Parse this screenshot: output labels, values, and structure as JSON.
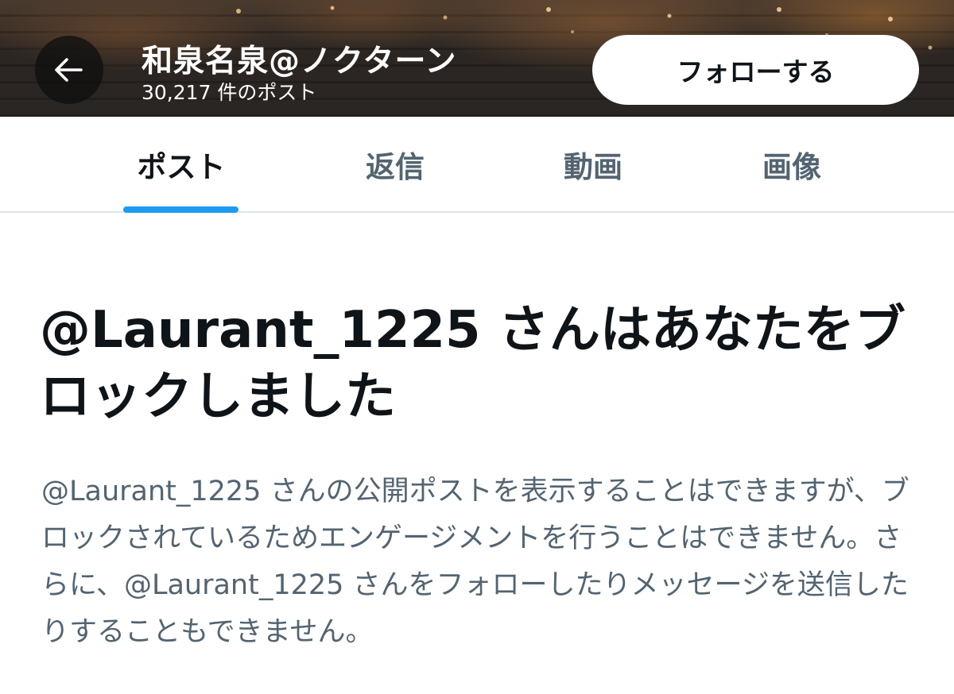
{
  "header": {
    "profile_name": "和泉名泉@ノクターン",
    "post_count": "30,217 件のポスト",
    "follow_label": "フォローする",
    "back_icon": "arrow-left-icon"
  },
  "tabs": [
    {
      "label": "ポスト",
      "active": true
    },
    {
      "label": "返信",
      "active": false
    },
    {
      "label": "動画",
      "active": false
    },
    {
      "label": "画像",
      "active": false
    }
  ],
  "message": {
    "title": "@Laurant_1225 さんはあなたをブロックしました",
    "description": "@Laurant_1225 さんの公開ポストを表示することはできますが、ブロックされているためエンゲージメントを行うことはできません。さらに、@Laurant_1225 さんをフォローしたりメッセージを送信したりすることもできません。"
  },
  "colors": {
    "accent": "#1d9bf0",
    "text_primary": "#0f1419",
    "text_secondary": "#536471",
    "divider": "#e2e6e9"
  }
}
